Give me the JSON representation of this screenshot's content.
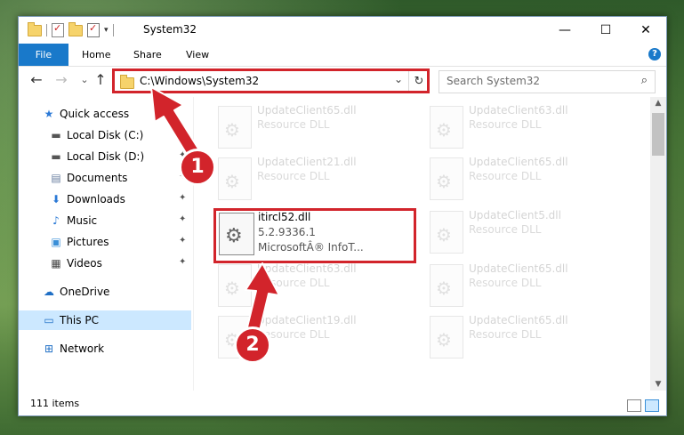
{
  "window": {
    "title": "System32",
    "controls": {
      "minimize": "—",
      "maximize": "☐",
      "close": "✕"
    }
  },
  "ribbon": {
    "file": "File",
    "tabs": [
      "Home",
      "Share",
      "View"
    ],
    "help": "?"
  },
  "address": {
    "path": "C:\\Windows\\System32",
    "dropdown": "⌄",
    "refresh": "↻"
  },
  "search": {
    "placeholder": "Search System32",
    "icon": "⌕"
  },
  "nav_icons": {
    "back": "←",
    "forward": "→",
    "recent": "⌄",
    "up": "↑"
  },
  "sidebar": {
    "items": [
      {
        "label": "Quick access",
        "icon": "★",
        "pinned": false
      },
      {
        "label": "Local Disk (C:)",
        "icon": "▬",
        "pinned": true
      },
      {
        "label": "Local Disk (D:)",
        "icon": "▬",
        "pinned": true
      },
      {
        "label": "Documents",
        "icon": "▤",
        "pinned": true
      },
      {
        "label": "Downloads",
        "icon": "⬇",
        "pinned": true
      },
      {
        "label": "Music",
        "icon": "♪",
        "pinned": true
      },
      {
        "label": "Pictures",
        "icon": "▣",
        "pinned": true
      },
      {
        "label": "Videos",
        "icon": "▦",
        "pinned": true
      },
      {
        "label": "OneDrive",
        "icon": "☁",
        "pinned": false
      },
      {
        "label": "This PC",
        "icon": "▭",
        "pinned": false,
        "selected": true
      },
      {
        "label": "Network",
        "icon": "⊞",
        "pinned": false
      }
    ],
    "pin_icon": "📌"
  },
  "files": {
    "tiles": [
      {
        "name": "UpdateClient65.dll",
        "desc": "Resource DLL"
      },
      {
        "name": "UpdateClient63.dll",
        "desc": "Resource DLL"
      },
      {
        "name": "UpdateClient21.dll",
        "desc": "Resource DLL"
      },
      {
        "name": "UpdateClient65.dll",
        "desc": "Resource DLL"
      },
      {
        "name": "UpdateClient5.dll",
        "desc": "Resource DLL"
      },
      {
        "name": "UpdateClient63.dll",
        "desc": "Resource DLL"
      },
      {
        "name": "UpdateClient65.dll",
        "desc": "Resource DLL"
      },
      {
        "name": "UpdateClient19.dll",
        "desc": "Resource DLL"
      },
      {
        "name": "UpdateClient65.dll",
        "desc": "Resource DLL"
      }
    ],
    "featured": {
      "name": "itircl52.dll",
      "version": "5.2.9336.1",
      "company": "MicrosoftÂ® InfoT..."
    }
  },
  "status": {
    "count": "111 items"
  },
  "annotations": {
    "step1": "1",
    "step2": "2",
    "color": "#d2242b"
  }
}
